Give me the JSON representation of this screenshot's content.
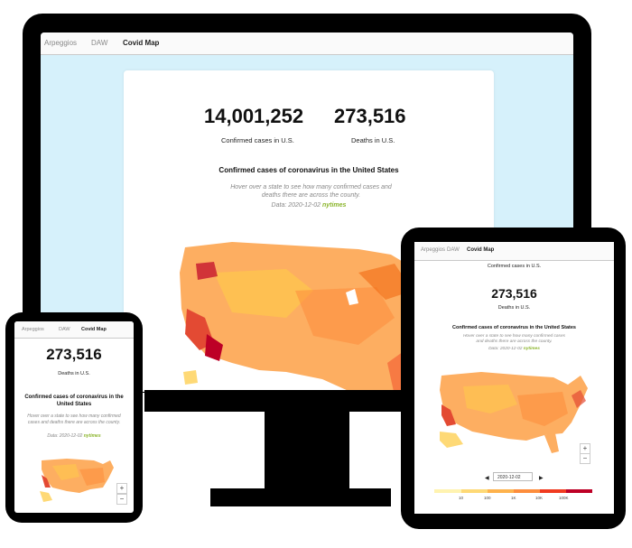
{
  "nav": {
    "items": [
      "Arpeggios",
      "DAW",
      "Covid Map"
    ],
    "active_index": 2
  },
  "stats": {
    "confirmed_value": "14,001,252",
    "confirmed_label": "Confirmed cases in U.S.",
    "deaths_value": "273,516",
    "deaths_label": "Deaths in U.S."
  },
  "map": {
    "title": "Confirmed cases of coronavirus in the United States",
    "description": "Hover over a state to see how many confirmed cases and deaths there are across the county.",
    "source_prefix": "Data: 2020-12-02",
    "source_link": "nytimes"
  },
  "controls": {
    "date_value": "2020-12-02",
    "zoom_in": "+",
    "zoom_out": "−",
    "prev_icon": "◀",
    "next_icon": "▶"
  },
  "legend": {
    "ticks": [
      "10",
      "100",
      "1K",
      "10K",
      "100K"
    ],
    "colors": [
      "#fff3b0",
      "#fed976",
      "#feb24c",
      "#fd8d3c",
      "#f03b20",
      "#bd0026"
    ]
  },
  "colors": {
    "accent_link": "#8ab42a",
    "screen_bg": "#d6f1fb",
    "map_low": "#fed976",
    "map_mid": "#fd8d3c",
    "map_high": "#bd0026"
  }
}
